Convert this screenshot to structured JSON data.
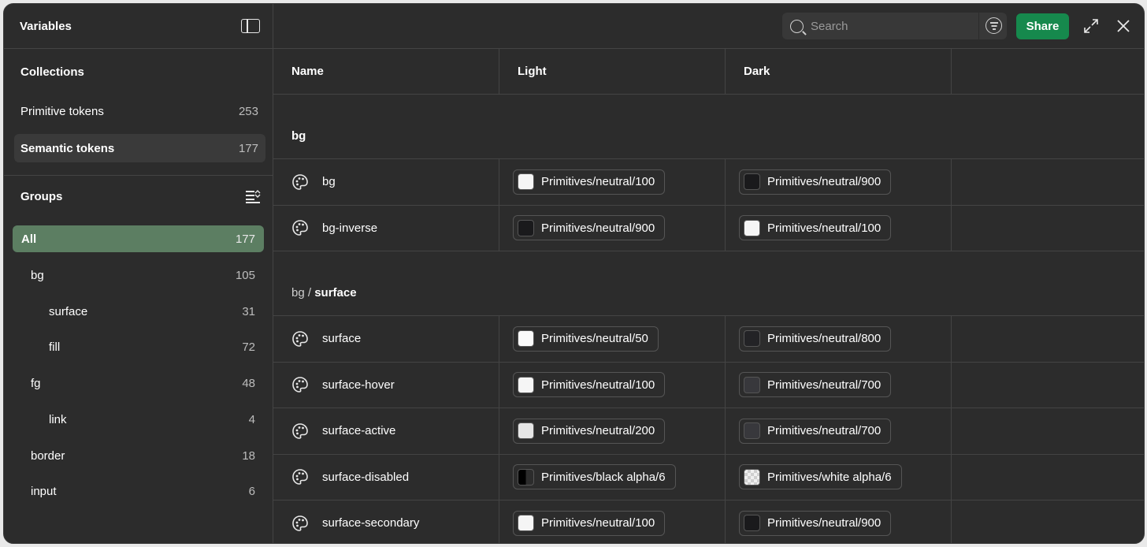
{
  "sidebar": {
    "title": "Variables",
    "collections_heading": "Collections",
    "collections": [
      {
        "label": "Primitive tokens",
        "count": "253"
      },
      {
        "label": "Semantic tokens",
        "count": "177"
      }
    ],
    "groups_heading": "Groups",
    "groups": [
      {
        "label": "All",
        "count": "177"
      },
      {
        "label": "bg",
        "count": "105"
      },
      {
        "label": "surface",
        "count": "31"
      },
      {
        "label": "fill",
        "count": "72"
      },
      {
        "label": "fg",
        "count": "48"
      },
      {
        "label": "link",
        "count": "4"
      },
      {
        "label": "border",
        "count": "18"
      },
      {
        "label": "input",
        "count": "6"
      }
    ]
  },
  "topbar": {
    "search_placeholder": "Search",
    "share_label": "Share"
  },
  "table": {
    "headers": [
      "Name",
      "Light",
      "Dark"
    ],
    "group_bg": "bg",
    "group_surface_prefix": "bg /",
    "group_surface": "surface",
    "rows": [
      {
        "name": "bg",
        "light": "Primitives/neutral/100",
        "light_color": "#f5f5f5",
        "dark": "Primitives/neutral/900",
        "dark_color": "#1a1a1c"
      },
      {
        "name": "bg-inverse",
        "light": "Primitives/neutral/900",
        "light_color": "#1a1a1c",
        "dark": "Primitives/neutral/100",
        "dark_color": "#f5f5f5"
      },
      {
        "name": "surface",
        "light": "Primitives/neutral/50",
        "light_color": "#fafafa",
        "dark": "Primitives/neutral/800",
        "dark_color": "#232326"
      },
      {
        "name": "surface-hover",
        "light": "Primitives/neutral/100",
        "light_color": "#f5f5f5",
        "dark": "Primitives/neutral/700",
        "dark_color": "#38383c"
      },
      {
        "name": "surface-active",
        "light": "Primitives/neutral/200",
        "light_color": "#e6e6e6",
        "dark": "Primitives/neutral/700",
        "dark_color": "#38383c"
      },
      {
        "name": "surface-disabled",
        "light": "Primitives/black alpha/6",
        "light_color": "black-alpha",
        "dark": "Primitives/white alpha/6",
        "dark_color": "white-alpha"
      },
      {
        "name": "surface-secondary",
        "light": "Primitives/neutral/100",
        "light_color": "#f5f5f5",
        "dark": "Primitives/neutral/900",
        "dark_color": "#1a1a1c"
      }
    ]
  },
  "colors": {
    "accent_green": "#16894d",
    "active_group": "#5c7e62"
  }
}
